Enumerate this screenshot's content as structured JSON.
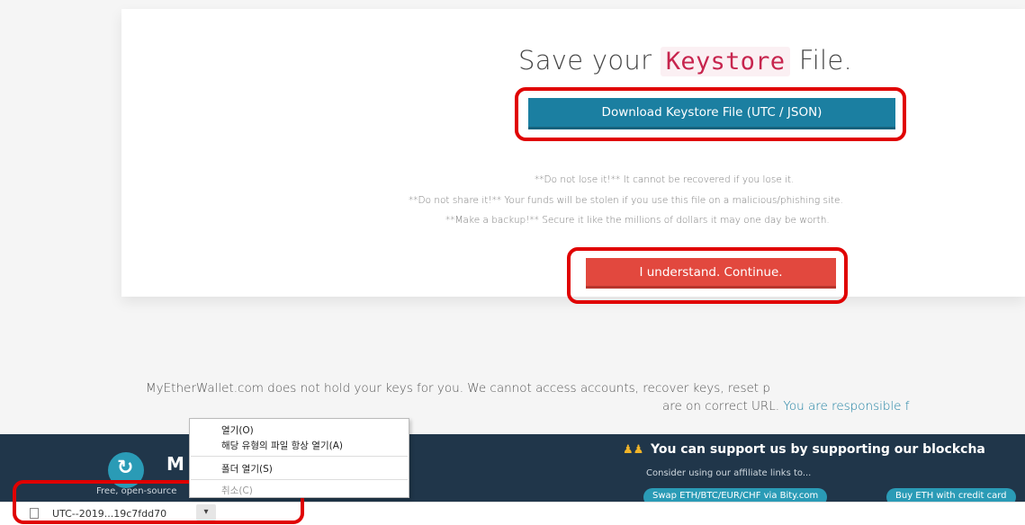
{
  "save_section": {
    "title_prefix": "Save your",
    "title_code": "Keystore",
    "title_suffix": "File.",
    "download_button": "Download Keystore File (UTC / JSON)",
    "warnings": [
      "**Do not lose it!** It cannot be recovered if you lose it.",
      "**Do not share it!** Your funds will be stolen if you use this file on a malicious/phishing site.",
      "**Make a backup!** Secure it like the millions of dollars it may one day be worth."
    ],
    "continue_button": "I understand. Continue."
  },
  "disclaimer": {
    "line1": "MyEtherWallet.com does not hold your keys for you. We cannot access accounts, recover keys, reset p",
    "line2_text": "are on correct URL.",
    "line2_link": "You are responsible f"
  },
  "footer": {
    "brand": "M",
    "tagline": "Free, open-source",
    "support_title": "You can support us by supporting our blockcha",
    "support_sub": "Consider using our affiliate links to...",
    "affiliate_1": "Swap ETH/BTC/EUR/CHF via Bity.com",
    "affiliate_2": "Buy ETH with credit card"
  },
  "context_menu": {
    "items": [
      "열기(O)",
      "해당 유형의 파일 항상 열기(A)",
      "폴더 열기(S)",
      "취소(C)"
    ]
  },
  "download_bar": {
    "file_name": "UTC--2019...19c7fdd70",
    "chevron": "v"
  },
  "colors": {
    "accent": "#1b7fa1",
    "danger": "#e2483e",
    "highlight": "#e00000",
    "footer_bg": "#20364a"
  }
}
